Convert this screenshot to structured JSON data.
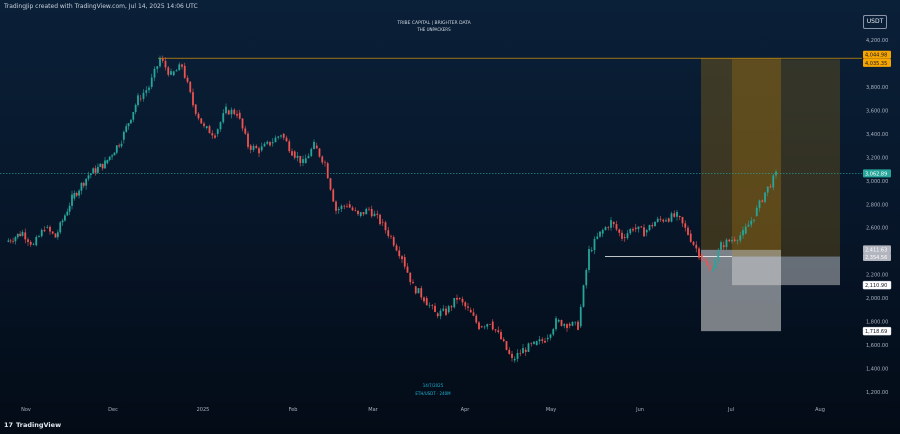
{
  "header": {
    "source_text": "TradingJip created with TradingView.com, Jul 14, 2025 14:06 UTC",
    "currency": "USDT"
  },
  "watermark": {
    "line1": "TRIBE CAPITAL | BRIGHTER DATA",
    "line2": "THE UNPACKERS"
  },
  "footer": {
    "logo_mark": "17",
    "logo_text": "TradingView"
  },
  "chart_data": {
    "type": "candlestick",
    "title": "",
    "symbol_label": "ETH/USDT · 240M",
    "date_annotation": "14/7/2025",
    "y_axis": {
      "ticks": [
        "4,200.00",
        "4,000.00",
        "3,800.00",
        "3,600.00",
        "3,400.00",
        "3,200.00",
        "3,000.00",
        "2,800.00",
        "2,600.00",
        "2,400.00",
        "2,200.00",
        "2,000.00",
        "1,800.00",
        "1,600.00",
        "1,400.00",
        "1,200.00"
      ],
      "range": [
        1200,
        4200
      ]
    },
    "x_axis": {
      "ticks": [
        "Nov",
        "Dec",
        "2025",
        "Feb",
        "Mar",
        "Apr",
        "May",
        "Jun",
        "Jul",
        "Aug"
      ]
    },
    "price_path": [
      [
        0,
        2480
      ],
      [
        3,
        2560
      ],
      [
        5,
        2450
      ],
      [
        7,
        2600
      ],
      [
        9,
        2520
      ],
      [
        12,
        2850
      ],
      [
        15,
        3050
      ],
      [
        18,
        3150
      ],
      [
        21,
        3350
      ],
      [
        24,
        3700
      ],
      [
        26,
        3800
      ],
      [
        28,
        4040
      ],
      [
        30,
        3900
      ],
      [
        32,
        3980
      ],
      [
        34,
        3650
      ],
      [
        36,
        3450
      ],
      [
        38,
        3400
      ],
      [
        40,
        3600
      ],
      [
        42,
        3580
      ],
      [
        44,
        3300
      ],
      [
        46,
        3260
      ],
      [
        48,
        3320
      ],
      [
        50,
        3400
      ],
      [
        52,
        3250
      ],
      [
        54,
        3150
      ],
      [
        56,
        3300
      ],
      [
        58,
        3150
      ],
      [
        60,
        2750
      ],
      [
        62,
        2800
      ],
      [
        64,
        2700
      ],
      [
        66,
        2760
      ],
      [
        68,
        2650
      ],
      [
        70,
        2520
      ],
      [
        72,
        2350
      ],
      [
        74,
        2100
      ],
      [
        76,
        2000
      ],
      [
        78,
        1870
      ],
      [
        80,
        1880
      ],
      [
        82,
        2000
      ],
      [
        84,
        1900
      ],
      [
        86,
        1760
      ],
      [
        88,
        1800
      ],
      [
        90,
        1650
      ],
      [
        92,
        1470
      ],
      [
        94,
        1560
      ],
      [
        96,
        1600
      ],
      [
        98,
        1650
      ],
      [
        100,
        1800
      ],
      [
        102,
        1780
      ],
      [
        104,
        1760
      ],
      [
        106,
        2400
      ],
      [
        108,
        2550
      ],
      [
        110,
        2650
      ],
      [
        112,
        2520
      ],
      [
        114,
        2600
      ],
      [
        116,
        2560
      ],
      [
        118,
        2650
      ],
      [
        120,
        2680
      ],
      [
        122,
        2700
      ],
      [
        124,
        2550
      ],
      [
        126,
        2380
      ],
      [
        128,
        2230
      ],
      [
        130,
        2450
      ],
      [
        132,
        2500
      ],
      [
        134,
        2550
      ],
      [
        136,
        2700
      ],
      [
        138,
        2900
      ],
      [
        140,
        3050
      ]
    ],
    "price_lines": [
      {
        "label": "4,044.98",
        "value": 4044.98,
        "color": "#f7a600"
      },
      {
        "label": "4,035.35",
        "value": 4035.35,
        "color": "#f7a600"
      },
      {
        "label": "3,062.89",
        "value": 3062.89,
        "color": "#26a69a"
      },
      {
        "label": "2,411.63",
        "value": 2411.63,
        "color": "#b2b5be"
      },
      {
        "label": "2,354.56",
        "value": 2354.56,
        "color": "#b2b5be"
      },
      {
        "label": "2,110.90",
        "value": 2110.9,
        "color": "#ffffff"
      },
      {
        "label": "1,718.69",
        "value": 1718.69,
        "color": "#ffffff"
      }
    ],
    "zones": [
      {
        "name": "long-position-A",
        "target": 4044.98,
        "entry": 2411.63,
        "stop": 1718.69
      },
      {
        "name": "long-position-B",
        "target": 4035.35,
        "entry": 2354.56,
        "stop": 2110.9
      }
    ],
    "support_level": 2354.56,
    "grid": false
  }
}
